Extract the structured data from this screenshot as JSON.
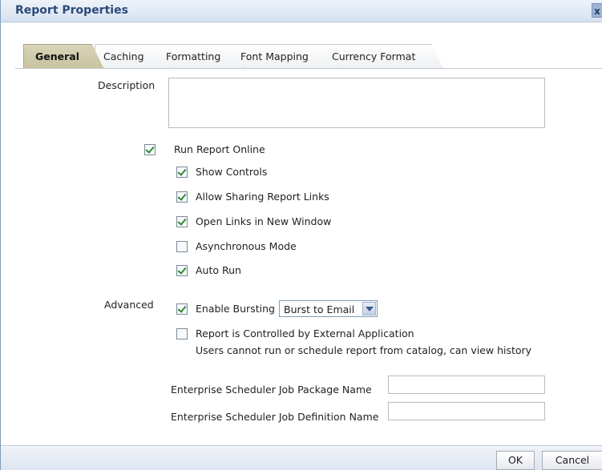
{
  "dialog": {
    "title": "Report Properties",
    "close_label": "x"
  },
  "tabs": [
    {
      "label": "General",
      "active": true
    },
    {
      "label": "Caching",
      "active": false
    },
    {
      "label": "Formatting",
      "active": false
    },
    {
      "label": "Font Mapping",
      "active": false
    },
    {
      "label": "Currency Format",
      "active": false
    }
  ],
  "general": {
    "description_label": "Description",
    "description_value": "",
    "run_report_online": {
      "label": "Run Report Online",
      "checked": true
    },
    "options": [
      {
        "label": "Show Controls",
        "checked": true
      },
      {
        "label": "Allow Sharing Report Links",
        "checked": true
      },
      {
        "label": "Open Links in New Window",
        "checked": true
      },
      {
        "label": "Asynchronous Mode",
        "checked": false
      },
      {
        "label": "Auto Run",
        "checked": true
      }
    ],
    "advanced_label": "Advanced",
    "enable_bursting": {
      "label": "Enable Bursting",
      "checked": true
    },
    "bursting_select_value": "Burst to Email",
    "external_app": {
      "label": "Report is Controlled by External Application",
      "checked": false,
      "note": "Users cannot run or schedule report from catalog, can view history"
    },
    "job_package_label": "Enterprise Scheduler Job Package Name",
    "job_package_value": "",
    "job_definition_label": "Enterprise Scheduler Job Definition Name",
    "job_definition_value": ""
  },
  "footer": {
    "ok_label": "OK",
    "cancel_label": "Cancel"
  }
}
